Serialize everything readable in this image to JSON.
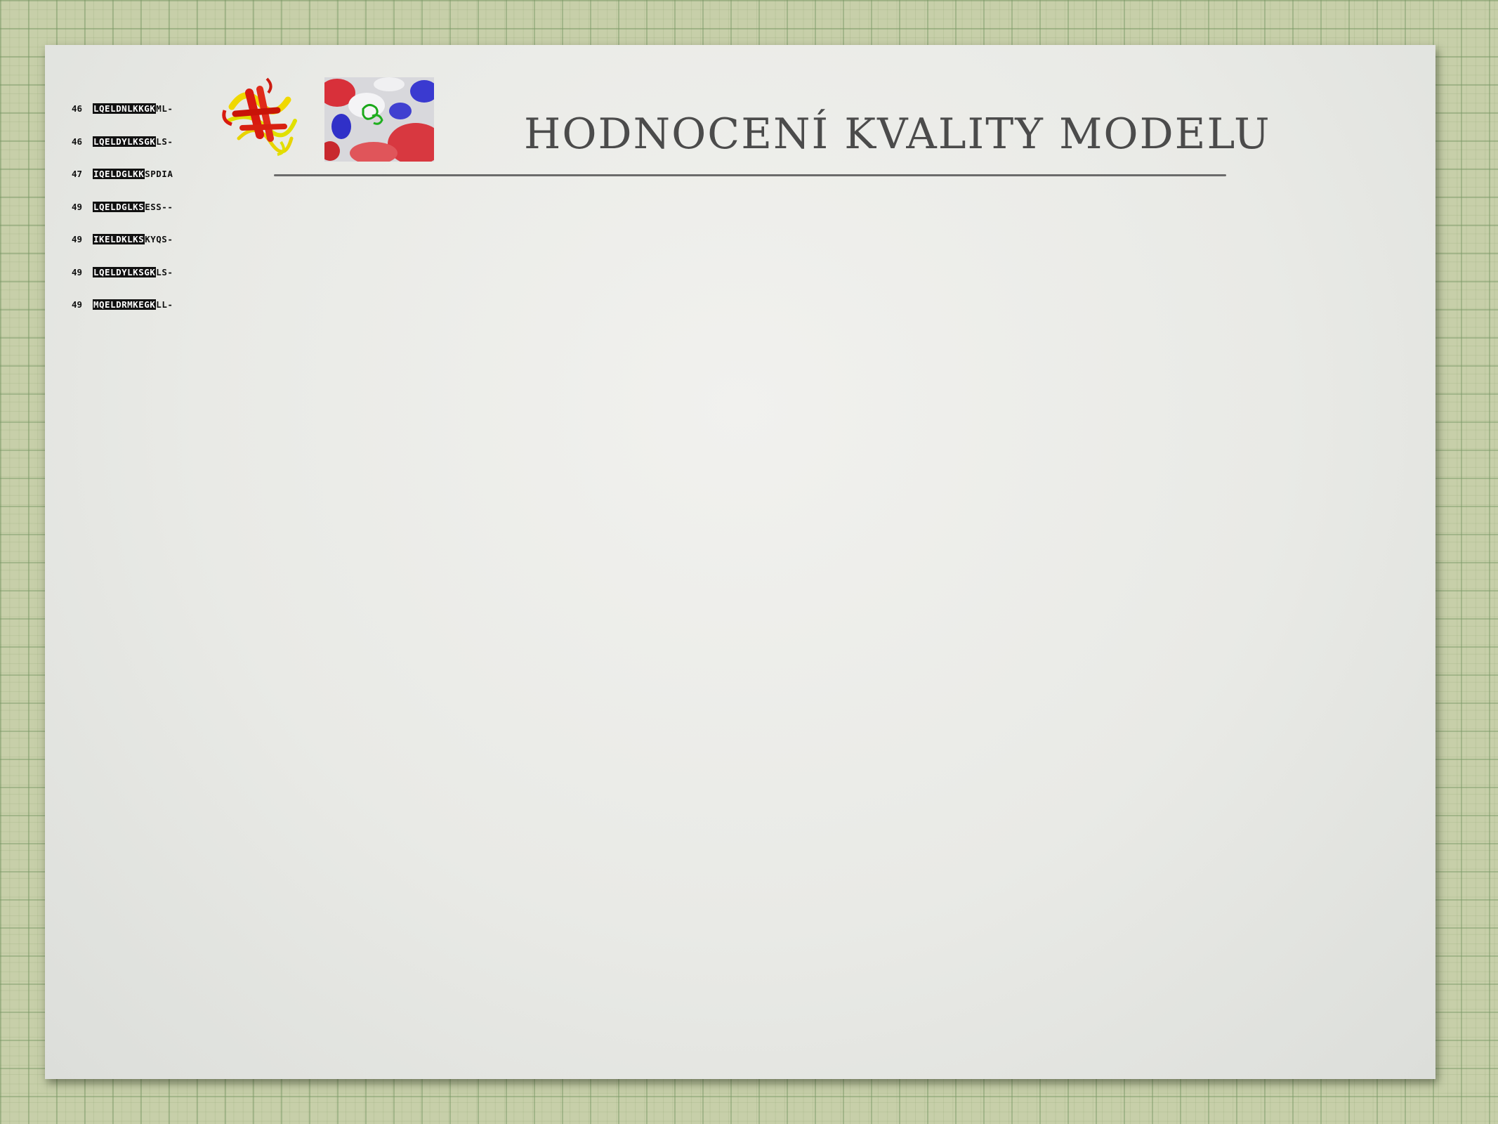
{
  "slide": {
    "title": "HODNOCENÍ KVALITY MODELU"
  },
  "alignment": {
    "rows": [
      {
        "num": "46",
        "block": "LQELDNLKKGK",
        "tail": "ML-"
      },
      {
        "num": "46",
        "block": "LQELDYLKSGK",
        "tail": "LS-"
      },
      {
        "num": "47",
        "block": "IQELDGLKK",
        "tail": "SPDIA"
      },
      {
        "num": "49",
        "block": "LQELDGLKS",
        "tail": "ESS--"
      },
      {
        "num": "49",
        "block": "IKELDKLKS",
        "tail": "KYQS-"
      },
      {
        "num": "49",
        "block": "LQELDYLKSGK",
        "tail": "LS-"
      },
      {
        "num": "49",
        "block": "MQELDRMKEGK",
        "tail": "LL-"
      }
    ]
  },
  "colors": {
    "background": "#c7cfa9",
    "slide": "#ececea",
    "title": "#4b4b4b",
    "rule": "#6b6b6b"
  },
  "icons": [
    "sequence-alignment-image",
    "protein-ribbon-image",
    "protein-surface-image"
  ]
}
